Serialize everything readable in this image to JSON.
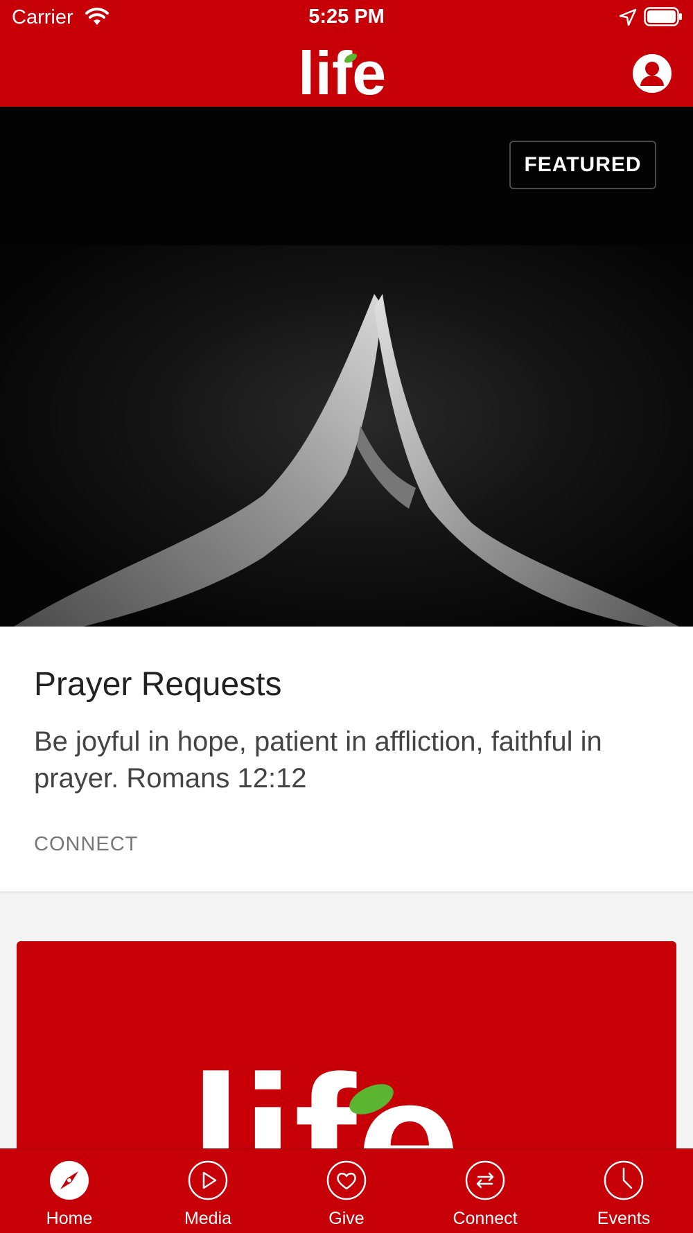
{
  "status_bar": {
    "carrier": "Carrier",
    "time": "5:25 PM",
    "icons": [
      "wifi-icon",
      "location-arrow-icon",
      "battery-icon"
    ]
  },
  "header": {
    "logo_text": "life",
    "profile_icon": "user-circle-icon"
  },
  "featured_card": {
    "badge": "FEATURED",
    "image": "praying-hands-photo",
    "title": "Prayer Requests",
    "description": "Be joyful in hope, patient in affliction, faithful in prayer. Romans 12:12",
    "tag": "CONNECT"
  },
  "second_card": {
    "logo_text": "life"
  },
  "tab_bar": {
    "items": [
      {
        "label": "Home",
        "icon": "compass-icon",
        "active": true
      },
      {
        "label": "Media",
        "icon": "play-circle-icon",
        "active": false
      },
      {
        "label": "Give",
        "icon": "heart-circle-icon",
        "active": false
      },
      {
        "label": "Connect",
        "icon": "swap-arrows-icon",
        "active": false
      },
      {
        "label": "Events",
        "icon": "clock-icon",
        "active": false
      }
    ]
  },
  "colors": {
    "brand_red": "#c60006",
    "leaf_green": "#5cb531",
    "white": "#ffffff"
  }
}
